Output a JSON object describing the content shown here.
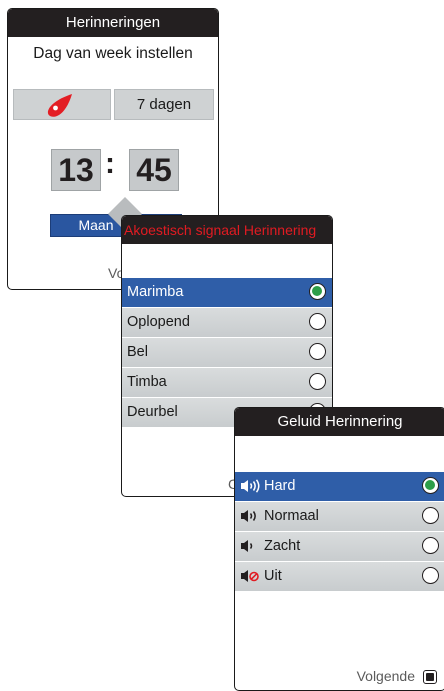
{
  "screen1": {
    "title": "Herinneringen",
    "subtitle": "Dag van week instellen",
    "days_label": "7 dagen",
    "hour": "13",
    "separator": ":",
    "minute": "45",
    "selected_day": "Maan",
    "next_label": "Vo"
  },
  "screen2": {
    "title": "Akoestisch signaal Herinnering",
    "items": [
      {
        "label": "Marimba",
        "selected": true
      },
      {
        "label": "Oplopend",
        "selected": false
      },
      {
        "label": "Bel",
        "selected": false
      },
      {
        "label": "Timba",
        "selected": false
      },
      {
        "label": "Deurbel",
        "selected": false
      }
    ],
    "next_label": "C"
  },
  "screen3": {
    "title": "Geluid Herinnering",
    "items": [
      {
        "label": "Hard",
        "icon": "speaker-loud-icon",
        "selected": true
      },
      {
        "label": "Normaal",
        "icon": "speaker-medium-icon",
        "selected": false
      },
      {
        "label": "Zacht",
        "icon": "speaker-low-icon",
        "selected": false
      },
      {
        "label": "Uit",
        "icon": "speaker-mute-icon",
        "selected": false
      }
    ],
    "next_label": "Volgende"
  },
  "colors": {
    "titlebar": "#231f20",
    "selection": "#2f5ea8",
    "radio_on": "#2e9e48",
    "alert_red": "#e11b22",
    "drop_red": "#e31e24"
  }
}
